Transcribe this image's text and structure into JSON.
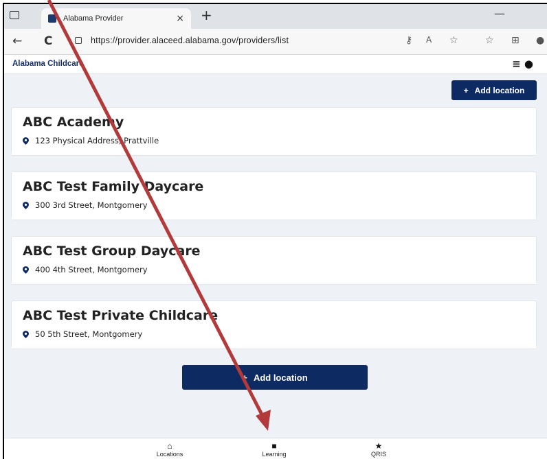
{
  "browser": {
    "tab_title": "Alabama Provider",
    "tab_close": "×",
    "new_tab": "+",
    "url": "https://provider.alaceed.alabama.gov/providers/list",
    "minimize": "—",
    "back": "←",
    "reload": "C"
  },
  "header": {
    "brand": "Alabama Childcare",
    "menu_icons": "≡ ●"
  },
  "actions": {
    "add_location_label": "Add location",
    "plus": "+"
  },
  "locations": [
    {
      "name": "ABC Academy",
      "address": "123 Physical Address, Prattville"
    },
    {
      "name": "ABC Test Family Daycare",
      "address": "300 3rd Street, Montgomery"
    },
    {
      "name": "ABC Test Group Daycare",
      "address": "400 4th Street, Montgomery"
    },
    {
      "name": "ABC Test Private Childcare",
      "address": "50 5th Street, Montgomery"
    }
  ],
  "bottom_nav": [
    {
      "label": "Locations",
      "icon": "home-icon"
    },
    {
      "label": "Learning",
      "icon": "book-icon"
    },
    {
      "label": "QRIS",
      "icon": "star-icon"
    }
  ],
  "colors": {
    "primary": "#0e2a63",
    "annotation_arrow": "#b23a3a"
  }
}
